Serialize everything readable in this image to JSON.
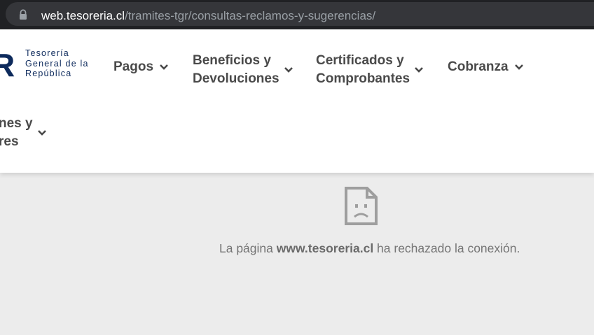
{
  "browser": {
    "url_domain": "web.tesoreria.cl",
    "url_path": "/tramites-tgr/consultas-reclamos-y-sugerencias/"
  },
  "header": {
    "logo": {
      "mark": "R",
      "line1": "Tesorería",
      "line2": "General de la",
      "line3": "República"
    },
    "nav": [
      {
        "label": "Pagos"
      },
      {
        "label": "Beneficios y\nDevoluciones"
      },
      {
        "label": "Certificados y\nComprobantes"
      },
      {
        "label": "Cobranza"
      },
      {
        "label": "nes y\nres"
      }
    ]
  },
  "error": {
    "prefix": "La página ",
    "domain": "www.tesoreria.cl",
    "suffix": " ha rechazado la conexión."
  },
  "colors": {
    "brand": "#0d2a5c",
    "nav_text": "#4a4a4a",
    "page_bg": "#ececec"
  }
}
